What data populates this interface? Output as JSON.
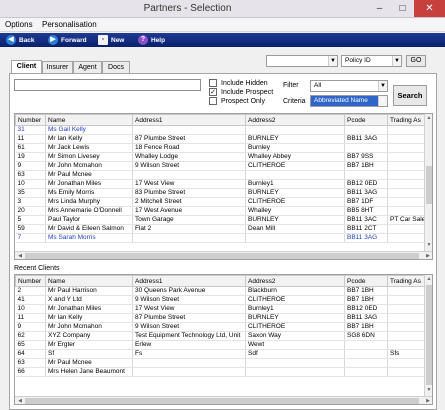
{
  "window": {
    "title": "Partners - Selection",
    "min_icon": "–",
    "max_icon": "□",
    "close_icon": "✕"
  },
  "menu": {
    "options": "Options",
    "personalisation": "Personalisation"
  },
  "toolbar": {
    "back": "Back",
    "forward": "Forward",
    "new": "New",
    "help": "Help"
  },
  "search_bar": {
    "combo_value": "",
    "field_value": "Policy ID",
    "go_label": "GO"
  },
  "tabs": [
    "Client",
    "Insurer",
    "Agent",
    "Docs"
  ],
  "filters": {
    "include_hidden": "Include Hidden",
    "include_prospect": "Include Prospect",
    "prospect_only": "Prospect Only",
    "include_prospect_checked": "✓",
    "filter_label": "Filter",
    "filter_value": "All",
    "criteria_label": "Criteria",
    "criteria_value": "Abbreviated Name",
    "search_label": "Search"
  },
  "columns": [
    "Number",
    "Name",
    "Address1",
    "Address2",
    "Pcode",
    "Trading As"
  ],
  "main_rows": [
    [
      "31",
      "Ms Gail Kelly",
      "",
      "",
      "",
      ""
    ],
    [
      "11",
      "Mr Ian Kelly",
      "87 Plumbe Street",
      "BURNLEY",
      "BB11 3AG",
      ""
    ],
    [
      "61",
      "Mr Jack Lewis",
      "18 Fence Road",
      "Burnley",
      "",
      ""
    ],
    [
      "19",
      "Mr Simon Livesey",
      "Whalley Lodge",
      "Whalley Abbey",
      "BB7 9SS",
      ""
    ],
    [
      "9",
      "Mr John Mcmahon",
      "9 Wilson Street",
      "CLITHEROE",
      "BB7 1BH",
      ""
    ],
    [
      "63",
      "Mr Paul Mcnee",
      "",
      "",
      "",
      ""
    ],
    [
      "10",
      "Mr Jonathan Miles",
      "17 West View",
      "Burnley1",
      "BB12 0ED",
      ""
    ],
    [
      "35",
      "Ms Emily Morris",
      "83 Plumbe Street",
      "BURNLEY",
      "BB11 3AG",
      ""
    ],
    [
      "3",
      "Mrs Linda Murphy",
      "2 Mitchell Street",
      "CLITHEROE",
      "BB7 1DF",
      ""
    ],
    [
      "20",
      "Mrs Annemarie O'Donnell",
      "17 West Avenue",
      "Whalley",
      "BB5 8HT",
      ""
    ],
    [
      "5",
      "Paul Taylor",
      "Town Garage",
      "BURNLEY",
      "BB11 3AC",
      "PT Car Sale"
    ],
    [
      "59",
      "Mr David & Eileen Salmon",
      "Flat 2",
      "Dean Mill",
      "BB11 2CT",
      ""
    ],
    [
      "7",
      "Ms Sarah Morris",
      "",
      "",
      "BB11 3AG",
      ""
    ]
  ],
  "recent_label": "Recent Clients",
  "recent_rows": [
    [
      "2",
      "Mr Paul Harrison",
      "30 Queens Park Avenue",
      "Blackburn",
      "BB7 1BH",
      ""
    ],
    [
      "41",
      "X and Y Ltd",
      "9 Wilson Street",
      "CLITHEROE",
      "BB7 1BH",
      ""
    ],
    [
      "10",
      "Mr Jonathan Miles",
      "17 West View",
      "Burnley1",
      "BB12 0ED",
      ""
    ],
    [
      "11",
      "Mr Ian Kelly",
      "87 Plumbe Street",
      "BURNLEY",
      "BB11 3AG",
      ""
    ],
    [
      "9",
      "Mr John Mcmahon",
      "9 Wilson Street",
      "CLITHEROE",
      "BB7 1BH",
      ""
    ],
    [
      "62",
      "XYZ Company",
      "Test Equipment Technology Ltd, Unit",
      "Saxon Way",
      "SG8 6DN",
      ""
    ],
    [
      "65",
      "Mr Ergter",
      "Erlew",
      "Wewt",
      "",
      ""
    ],
    [
      "64",
      "Sf",
      "Fs",
      "Sdf",
      "",
      "Sfs"
    ],
    [
      "63",
      "Mr Paul Mcnee",
      "",
      "",
      "",
      ""
    ],
    [
      "66",
      "Mrs Helen Jane Beaumont",
      "",
      "",
      "",
      ""
    ]
  ],
  "colors": {
    "toolbar": "#0a1f6b",
    "highlight": "#1f3fbf",
    "close": "#c7403d"
  }
}
